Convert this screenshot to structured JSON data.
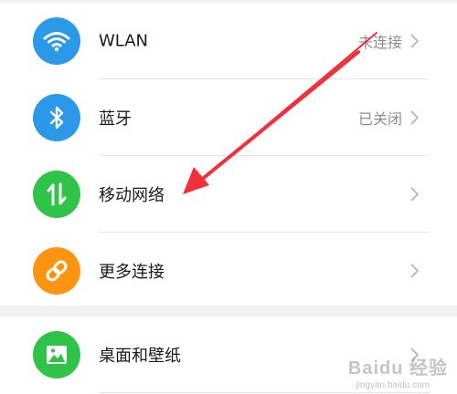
{
  "settings": {
    "items": [
      {
        "label": "WLAN",
        "status": "未连接",
        "icon": "wifi-icon",
        "color": "#2a9ae8"
      },
      {
        "label": "蓝牙",
        "status": "已关闭",
        "icon": "bluetooth-icon",
        "color": "#2a9ae8"
      },
      {
        "label": "移动网络",
        "status": "",
        "icon": "mobile-data-icon",
        "color": "#2fc34a"
      },
      {
        "label": "更多连接",
        "status": "",
        "icon": "link-icon",
        "color": "#ff9410"
      }
    ],
    "items2": [
      {
        "label": "桌面和壁纸",
        "status": "",
        "icon": "image-icon",
        "color": "#2fc34a"
      }
    ]
  },
  "annotation": {
    "arrow_color": "#f0303a"
  },
  "watermark": {
    "text": "Baidu 经验",
    "url": "jingyan.baidu.com"
  }
}
